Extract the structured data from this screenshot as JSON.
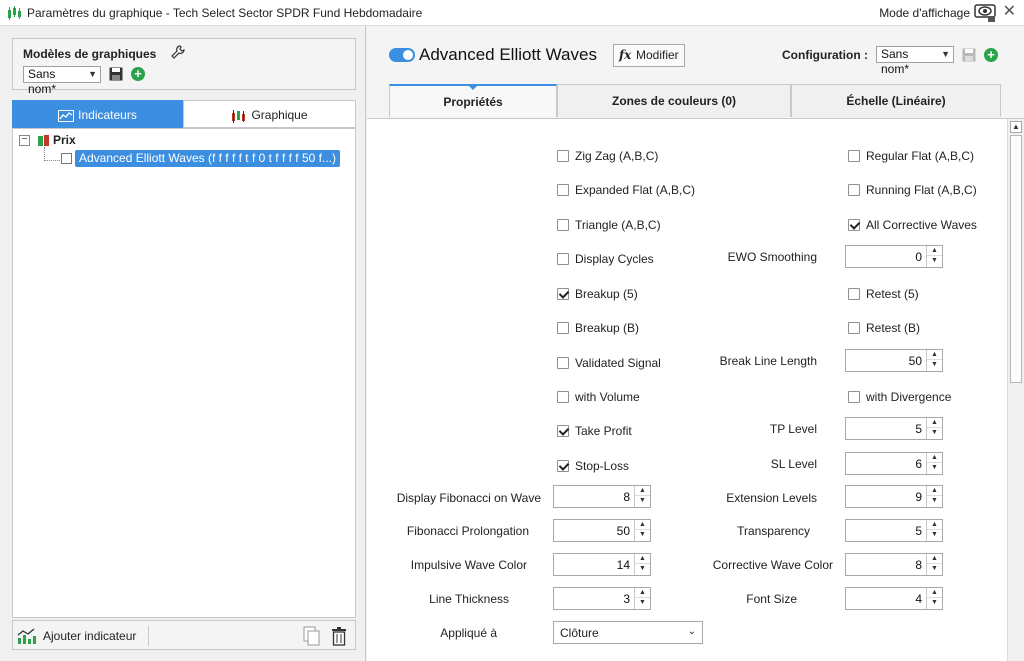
{
  "window": {
    "title": "Paramètres du graphique - Tech Select Sector SPDR Fund Hebdomadaire",
    "mode_label": "Mode d'affichage"
  },
  "left": {
    "models_label": "Modèles de graphiques",
    "models_select": "Sans nom*",
    "tabs": {
      "indicators": "Indicateurs",
      "chart": "Graphique"
    },
    "tree": {
      "root": "Prix",
      "child": "Advanced Elliott Waves (f f f f f t f 0 t f f f f 50 f...)"
    },
    "footer": {
      "add_indicator": "Ajouter indicateur"
    }
  },
  "right": {
    "indicator_title": "Advanced Elliott Waves",
    "modify_label": "Modifier",
    "fx_label": "fx",
    "config_label": "Configuration :",
    "config_select": "Sans nom*",
    "tabs": [
      "Propriétés",
      "Zones de couleurs (0)",
      "Échelle (Linéaire)"
    ],
    "checkboxes": {
      "zigzag": {
        "label": "Zig Zag (A,B,C)",
        "checked": false
      },
      "regular_flat": {
        "label": "Regular Flat (A,B,C)",
        "checked": false
      },
      "expanded_flat": {
        "label": "Expanded Flat (A,B,C)",
        "checked": false
      },
      "running_flat": {
        "label": "Running Flat (A,B,C)",
        "checked": false
      },
      "triangle": {
        "label": "Triangle (A,B,C)",
        "checked": false
      },
      "all_corrective": {
        "label": "All Corrective Waves",
        "checked": true
      },
      "display_cycles": {
        "label": "Display Cycles",
        "checked": false
      },
      "breakup5": {
        "label": "Breakup (5)",
        "checked": true
      },
      "retest5": {
        "label": "Retest (5)",
        "checked": false
      },
      "breakupB": {
        "label": "Breakup (B)",
        "checked": false
      },
      "retestB": {
        "label": "Retest (B)",
        "checked": false
      },
      "validated_signal": {
        "label": "Validated Signal",
        "checked": false
      },
      "with_volume": {
        "label": "with Volume",
        "checked": false
      },
      "with_divergence": {
        "label": "with Divergence",
        "checked": false
      },
      "take_profit": {
        "label": "Take Profit",
        "checked": true
      },
      "stop_loss": {
        "label": "Stop-Loss",
        "checked": true
      }
    },
    "fields": {
      "ewo_smoothing": {
        "label": "EWO Smoothing",
        "value": "0"
      },
      "break_line_length": {
        "label": "Break Line Length",
        "value": "50"
      },
      "tp_level": {
        "label": "TP Level",
        "value": "5"
      },
      "sl_level": {
        "label": "SL Level",
        "value": "6"
      },
      "display_fib": {
        "label": "Display Fibonacci on Wave",
        "value": "8"
      },
      "extension_levels": {
        "label": "Extension Levels",
        "value": "9"
      },
      "fib_prolongation": {
        "label": "Fibonacci Prolongation",
        "value": "50"
      },
      "transparency": {
        "label": "Transparency",
        "value": "5"
      },
      "impulsive_color": {
        "label": "Impulsive Wave Color",
        "value": "14"
      },
      "corrective_color": {
        "label": "Corrective Wave Color",
        "value": "8"
      },
      "line_thickness": {
        "label": "Line Thickness",
        "value": "3"
      },
      "font_size": {
        "label": "Font Size",
        "value": "4"
      }
    },
    "applied_to": {
      "label": "Appliqué à",
      "value": "Clôture"
    }
  },
  "colors": {
    "accent": "#3c8fe0",
    "add": "#2aa34a"
  }
}
